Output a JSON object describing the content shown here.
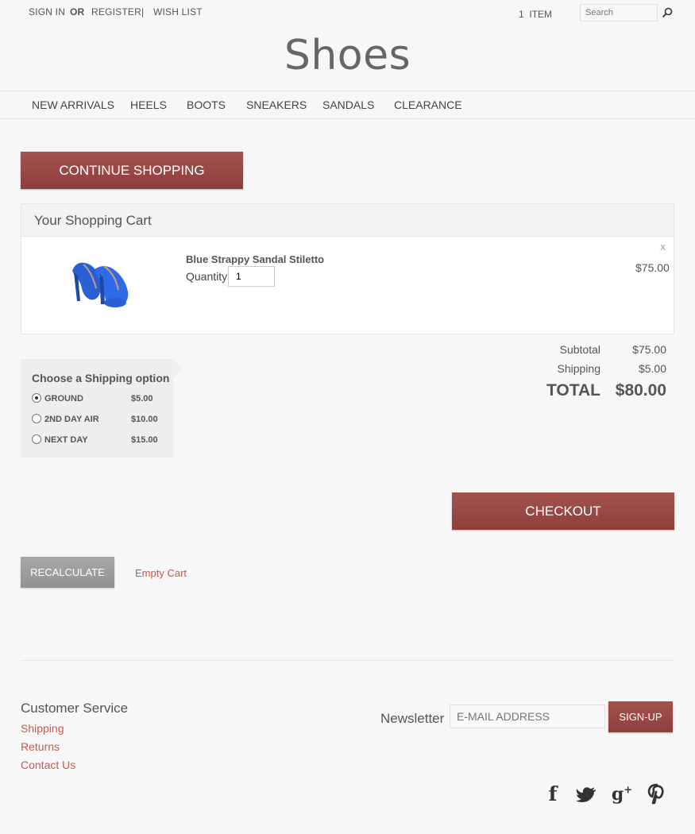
{
  "header": {
    "sign_in": "SIGN IN",
    "or": "OR",
    "register": "REGISTER",
    "separator": "|",
    "wish_list": "WISH LIST",
    "cart_count": "1",
    "cart_unit": "ITEM",
    "search_placeholder": "Search",
    "logo": "Shoes"
  },
  "nav": [
    "NEW ARRIVALS",
    "HEELS",
    "BOOTS",
    "SNEAKERS",
    "SANDALS",
    "CLEARANCE"
  ],
  "buttons": {
    "continue": "CONTINUE SHOPPING",
    "checkout": "CHECKOUT",
    "recalculate": "RECALCULATE",
    "empty_cart": "Empty Cart"
  },
  "cart": {
    "title": "Your Shopping Cart",
    "item": {
      "name": "Blue Strappy Sandal Stiletto",
      "quantity_label": "Quantity",
      "quantity": "1",
      "price": "$75.00",
      "remove": "x"
    }
  },
  "shipping": {
    "title": "Choose a Shipping option",
    "selected": 0,
    "options": [
      {
        "label": "GROUND",
        "price": "$5.00"
      },
      {
        "label": "2ND DAY AIR",
        "price": "$10.00"
      },
      {
        "label": "NEXT DAY",
        "price": "$15.00"
      }
    ]
  },
  "totals": {
    "subtotal_label": "Subtotal",
    "subtotal": "$75.00",
    "shipping_label": "Shipping",
    "shipping": "$5.00",
    "total_label": "TOTAL",
    "total": "$80.00"
  },
  "footer": {
    "cs_title": "Customer Service",
    "links": [
      "Shipping",
      "Returns",
      "Contact Us"
    ],
    "newsletter_label": "Newsletter",
    "newsletter_placeholder": "E-MAIL ADDRESS",
    "signup": "SIGN-UP",
    "social": [
      "facebook-icon",
      "twitter-icon",
      "google-plus-icon",
      "pinterest-icon"
    ]
  },
  "colors": {
    "accent": "#9a4a47",
    "link": "#c65a4d",
    "product": "#2a5fd6"
  }
}
